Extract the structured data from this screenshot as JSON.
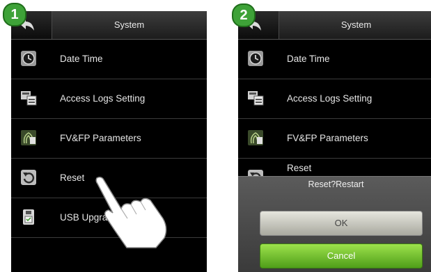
{
  "badges": [
    "1",
    "2"
  ],
  "screen1": {
    "title": "System",
    "items": [
      {
        "label": "Date Time",
        "icon": "clock-icon"
      },
      {
        "label": "Access Logs Setting",
        "icon": "logs-icon"
      },
      {
        "label": "FV&FP Parameters",
        "icon": "fingerprint-icon"
      },
      {
        "label": "Reset",
        "icon": "reset-icon"
      },
      {
        "label": "USB Upgra",
        "icon": "usb-icon"
      }
    ]
  },
  "screen2": {
    "title": "System",
    "items": [
      {
        "label": "Date Time",
        "icon": "clock-icon"
      },
      {
        "label": "Access Logs Setting",
        "icon": "logs-icon"
      },
      {
        "label": "FV&FP Parameters",
        "icon": "fingerprint-icon"
      },
      {
        "label": "Reset",
        "icon": "reset-icon"
      }
    ],
    "dialog": {
      "title": "Reset?Restart",
      "ok_label": "OK",
      "cancel_label": "Cancel"
    }
  },
  "colors": {
    "badge": "#3ea238",
    "cancel_button": "#6cc12b",
    "ok_button": "#d0d0c8"
  }
}
